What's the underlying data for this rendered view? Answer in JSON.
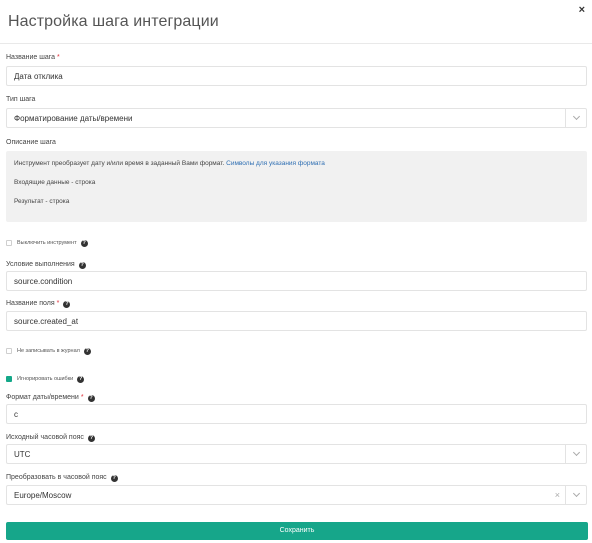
{
  "modal": {
    "title": "Настройка шага интеграции",
    "close_label": "×"
  },
  "fields": {
    "step_name": {
      "label": "Название шага",
      "value": "Дата отклика"
    },
    "step_type": {
      "label": "Тип шага",
      "value": "Форматирование даты/времени"
    },
    "description": {
      "label": "Описание шага",
      "text_before_link": "Инструмент преобразует дату и/или время в заданный Вами формат.",
      "link_text": "Символы для указания формата",
      "input_line": "Входящие данные - строка",
      "result_line": "Результат - строка"
    },
    "disable_tool": {
      "label": "Выключить инструмент",
      "checked": false
    },
    "condition": {
      "label": "Условие выполнения",
      "value": "source.condition"
    },
    "field_name": {
      "label": "Название поля",
      "value": "source.created_at"
    },
    "no_log": {
      "label": "Не записывать в журнал",
      "checked": false
    },
    "ignore_errors": {
      "label": "Игнорировать ошибки",
      "checked": true
    },
    "datetime_format": {
      "label": "Формат даты/времени",
      "value": "c"
    },
    "source_tz": {
      "label": "Исходный часовой пояс",
      "value": "UTC"
    },
    "target_tz": {
      "label": "Преобразовать в часовой пояс",
      "value": "Europe/Moscow"
    }
  },
  "required_mark": "*",
  "help_glyph": "?",
  "clear_glyph": "×",
  "save_label": "Сохранить",
  "colors": {
    "accent": "#16a68a",
    "link": "#2f6fb3",
    "required": "#e0303a"
  },
  "icons": {
    "help": "question-circle-icon",
    "close": "close-icon",
    "dropdown": "chevron-down-icon",
    "clear": "clear-icon"
  }
}
